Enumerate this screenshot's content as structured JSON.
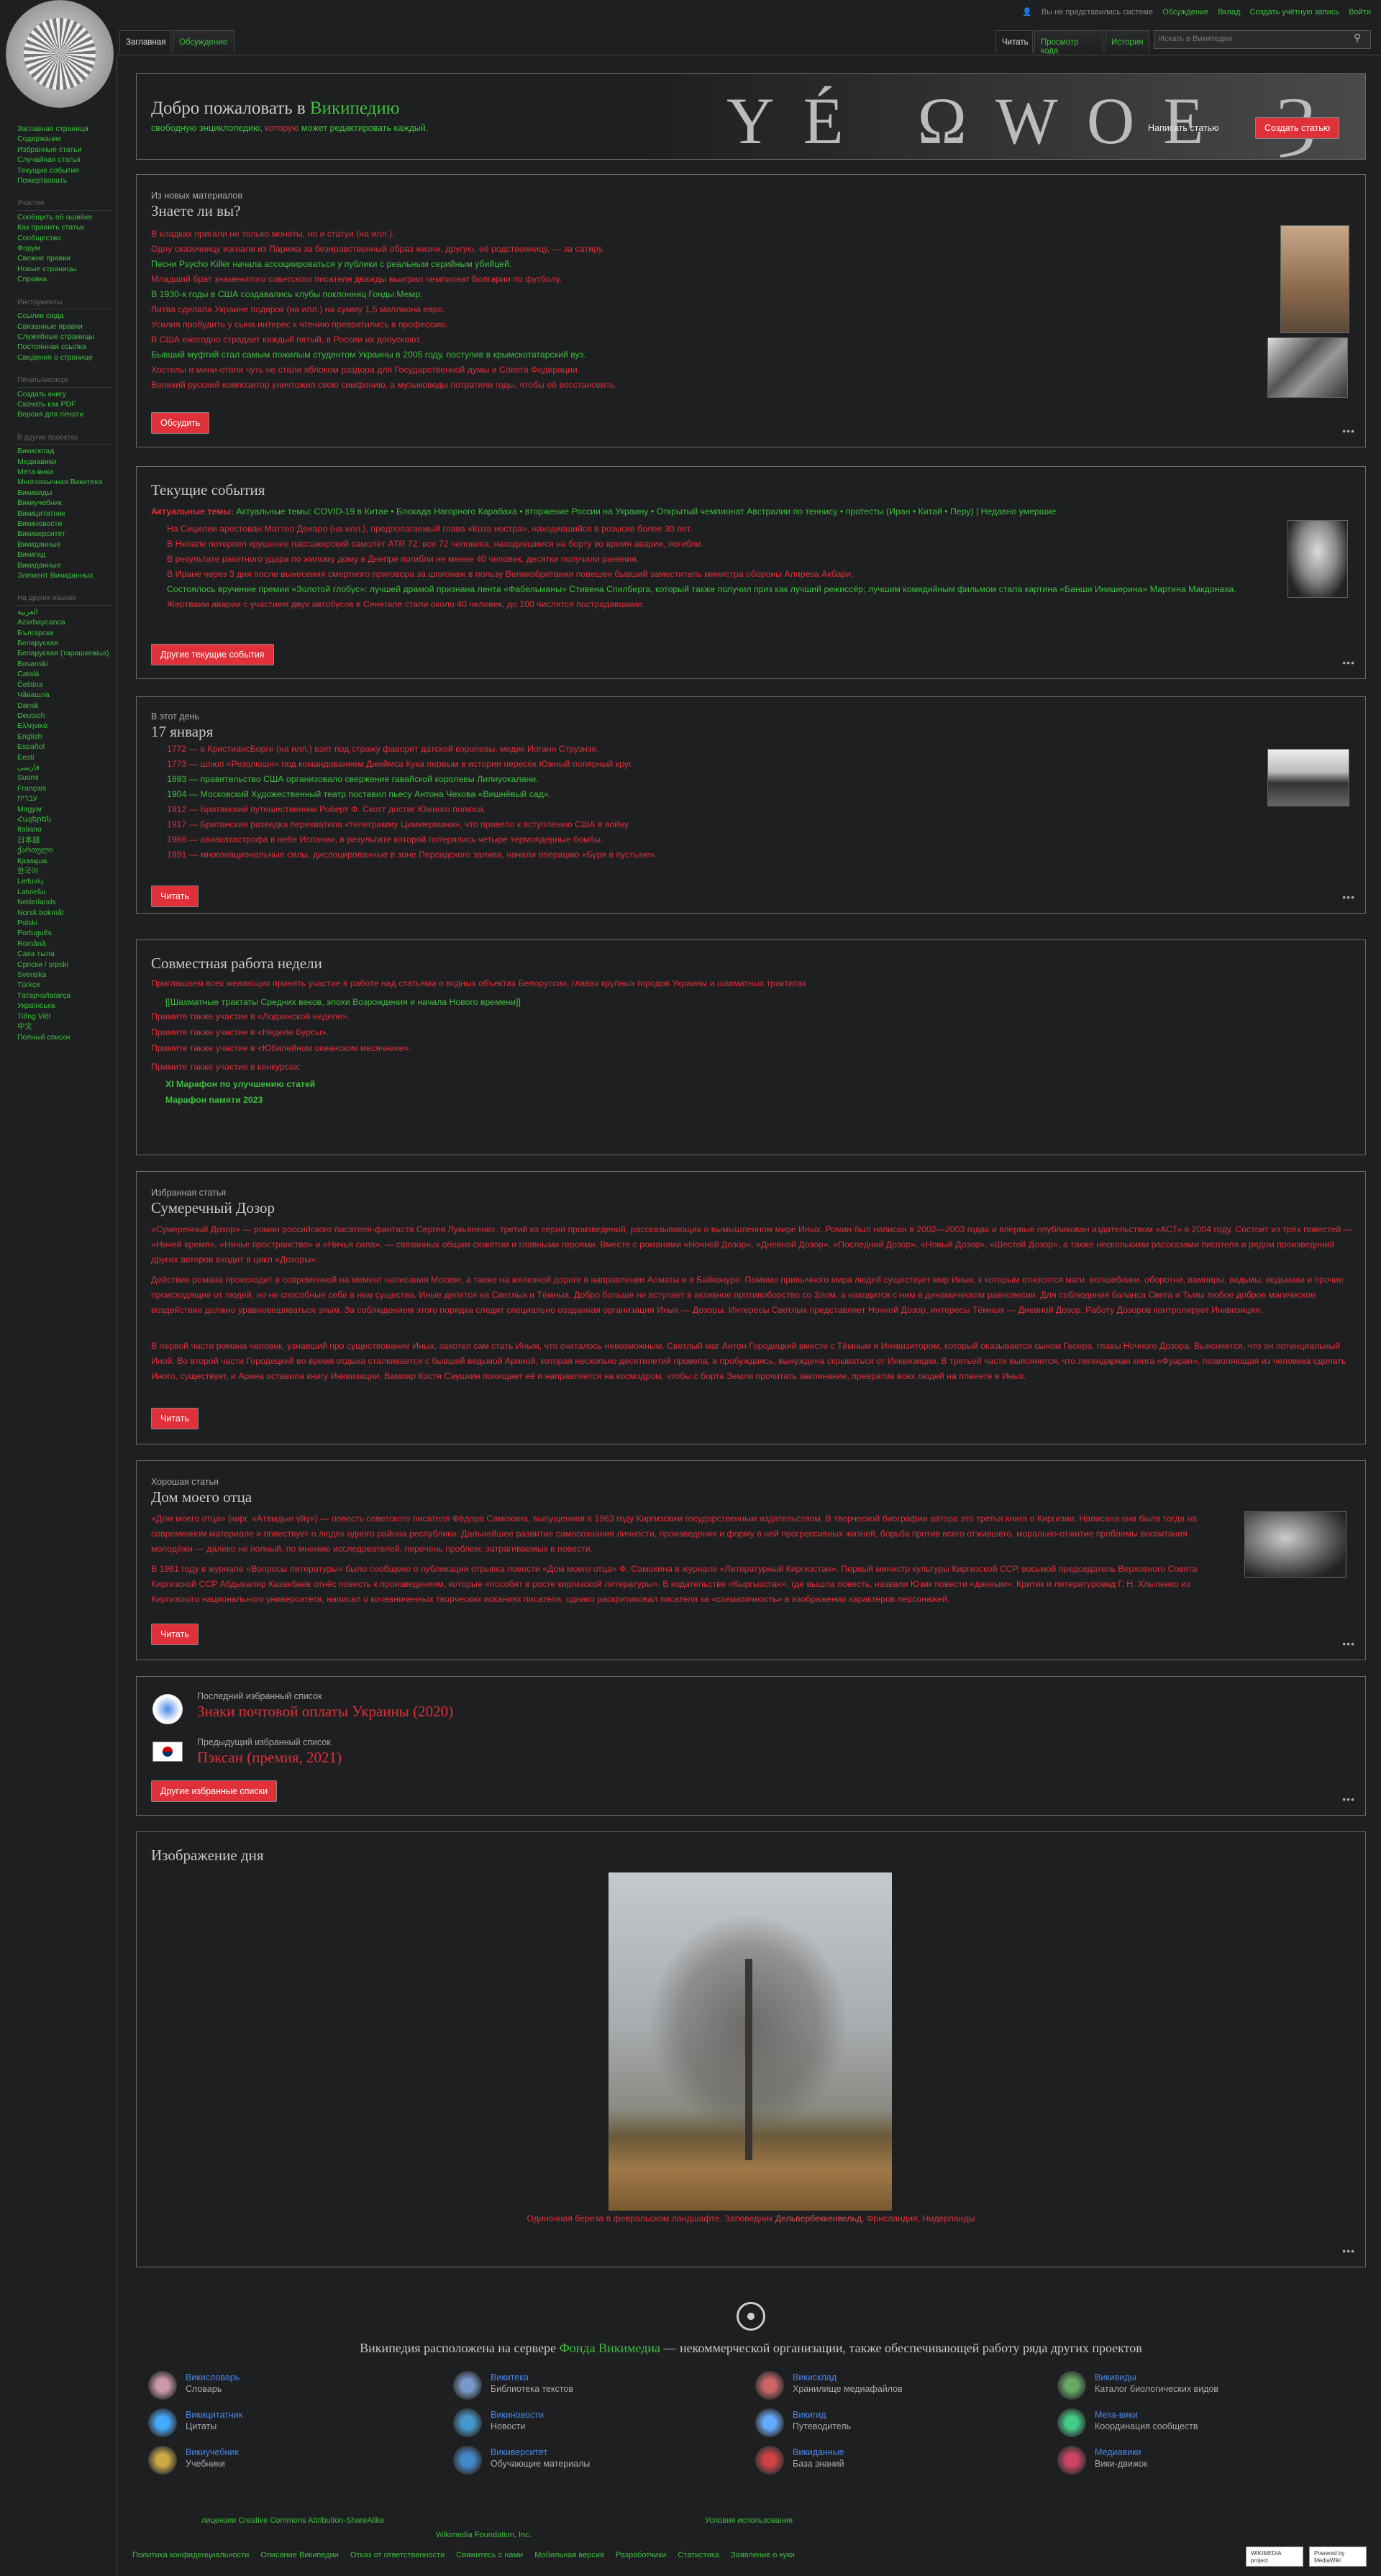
{
  "top": {
    "not_logged": "Вы не представились системе",
    "talk": "Обсуждение",
    "contributions": "Вклад",
    "create_account": "Создать учётную запись",
    "login": "Войти"
  },
  "tabs": {
    "main": "Заглавная",
    "discussion": "Обсуждение",
    "read": "Читать",
    "view_source": "Просмотр кода",
    "history": "История"
  },
  "search": {
    "placeholder": "Искать в Википедии"
  },
  "sidebar": {
    "nav": [
      "Заглавная страница",
      "Содержание",
      "Избранные статьи",
      "Случайная статья",
      "Текущие события",
      "Пожертвовать"
    ],
    "part_h": "Участие",
    "part": [
      "Сообщить об ошибке",
      "Как править статьи",
      "Сообщество",
      "Форум",
      "Свежие правки",
      "Новые страницы",
      "Справка"
    ],
    "tools_h": "Инструменты",
    "tools": [
      "Ссылки сюда",
      "Связанные правки",
      "Служебные страницы",
      "Постоянная ссылка",
      "Сведения о странице"
    ],
    "print_h": "Печать/экспорт",
    "print": [
      "Создать книгу",
      "Скачать как PDF",
      "Версия для печати"
    ],
    "other_h": "В других проектах",
    "other": [
      "Викисклад",
      "Медиавики",
      "Мета-вики",
      "Многоязычная Викитека",
      "Викивиды",
      "Викиучебник",
      "Викицитатник",
      "Викиновости",
      "Викиверситет",
      "Викиданные",
      "Викигид",
      "Викиданные",
      "Элемент Викиданных"
    ],
    "lang_h": "На других языках",
    "langs": [
      "العربية",
      "Azərbaycanca",
      "Български",
      "Беларуская",
      "Беларуская (тарашкевіца)",
      "Bosanski",
      "Català",
      "Čeština",
      "Чӑвашла",
      "Dansk",
      "Deutsch",
      "Ελληνικά",
      "English",
      "Español",
      "Eesti",
      "فارسی",
      "Suomi",
      "Français",
      "עברית",
      "Magyar",
      "Հայերեն",
      "Italiano",
      "日本語",
      "ქართული",
      "Қазақша",
      "한국어",
      "Lietuvių",
      "Latviešu",
      "Nederlands",
      "Norsk bokmål",
      "Polski",
      "Português",
      "Română",
      "Саха тыла",
      "Српски / srpski",
      "Svenska",
      "Türkçe",
      "Татарча/tatarça",
      "Українська",
      "Tiếng Việt",
      "中文",
      "Полный список"
    ]
  },
  "welcome": {
    "pre": "Добро пожаловать в ",
    "link": "Википедию",
    "line2a": "свободную энциклопедию, ",
    "line2b": "которую",
    "line2c": " может редактировать каждый.",
    "btn_write": "Написать статью",
    "btn_create": "Создать статью"
  },
  "dyk": {
    "sub": "Из новых материалов",
    "title": "Знаете ли вы?",
    "items": [
      "В кладках пригали не только монеты, но и статуи (на илл.).",
      "Одну сказочницу изгнали из Парижа за безнравственный образ жизни, другую, её родственницу, — за сатиру.",
      "Песни Psycho Killer начала ассоциироваться у публики с реальным серийным убийцей.",
      "Младший брат знаменитого советского писателя дважды выиграл чемпионат Болгарии по футболу.",
      "В 1930-х годы в США создавались клубы поклонниц Гонды Мемр.",
      "Литва сделала Украине подарок (на илл.) на сумму 1,5 миллиона евро.",
      "Усилия пробудить у сына интерес к чтению превратились в профессию.",
      "В США ежегодно страдает каждый пятый, в России их допускают.",
      "Бывший муфтий стал самым пожилым студентом Украины в 2005 году, поступив в крымскотатарский вуз.",
      "Хостелы и мини-отели чуть не стали яблоком раздора для Государственной думы и Совета Федерации.",
      "Великий русский композитор уничтожил свою симфонию, а музыковеды потратили годы, чтобы её восстановить."
    ],
    "btn": "Обсудить"
  },
  "news": {
    "title": "Текущие события",
    "topics": "Актуальные темы: COVID-19 в Китае • Блокада Нагорного Карабаха • вторжение России на Украину • Открытый чемпионат Австралии по теннису • протесты (Иран • Китай • Перу) | Недавно умершие",
    "items": [
      "На Сицилии арестован Маттео Денаро (на илл.), предполагаемый глава «Коза ностра», находившийся в розыске более 30 лет.",
      "В Непале потерпел крушение пассажирский самолёт ATR 72: все 72 человека, находившиеся на борту во время аварии, погибли.",
      "В результате ракетного удара по жилому дому в Днепре погибли не менее 40 человек, десятки получили ранения.",
      "В Иране через 3 дня после вынесения смертного приговора за шпионаж в пользу Великобритании повешен бывший заместитель министра обороны Алиреза Акбари.",
      "Состоялось вручение премии «Золотой глобус»: лучшей драмой признана лента «Фабельманы» Стивена Спилберга, который также получил приз как лучший режиссёр; лучшим комедийным фильмом стала картина «Банши Инишерина» Мартина Макдонаха.",
      "Жертвами аварии с участием двух автобусов в Сенегале стали около 40 человек, до 100 числятся пострадавшими."
    ],
    "btn": "Другие текущие события"
  },
  "day": {
    "sub": "В этот день",
    "title": "17 января",
    "items": [
      "1772 — в КристиансБорге (на илл.) взят под стражу фаворит датской королевы, медик Иоганн Струэнзе.",
      "1773 — шлюп «Резолюшн» под командованием Джеймса Кука первым в истории пересёк Южный полярный круг.",
      "1893 — правительство США организовало свержение гавайской королевы Лилиуокалани.",
      "1904 — Московский Художественный театр поставил пьесу Антона Чехова «Вишнёвый сад».",
      "1912 — Британский путешественник Роберт Ф. Скотт достиг Южного полюса.",
      "1917 — Британская разведка перехватила «телеграмму Циммермана», что привело к вступлению США в войну.",
      "1966 — авиакатастрофа в небе Испании, в результате которой потерялись четыре термоядерные бомбы.",
      "1991 — многонациональные силы, дислоцированные в зоне Персидского залива, начали операцию «Буря в пустыне»."
    ],
    "btn": "Читать"
  },
  "collab": {
    "title": "Совместная работа недели",
    "invite": "Приглашаем всех желающих принять участие в работе над статьями о водных объектах Белоруссии, главах крупных городов Украины и шахматных трактатах",
    "bracket": "[[Шахматные трактаты Средних веков, эпохи Возрождения и начала Нового времени]]",
    "l1": "Примите также участие в «Лодзинской неделе».",
    "l2": "Примите также участие в «Неделе Бурсы».",
    "l3": "Примите также участие в «Юбилейном океанском месячнике».",
    "l4": "Примите также участие в конкурсах:",
    "c1": "XI Марафон по улучшению статей",
    "c2": "Марафон памяти 2023"
  },
  "feat": {
    "sub": "Избранная статья",
    "title": "Сумеречный Дозор",
    "p1": "«Сумеречный Дозор» — роман российского писателя-фантаста Сергея Лукьяненко, третий из серии произведений, рассказывающих о вымышленном мире Иных. Роман был написан в 2002—2003 годах и впервые опубликован издательством «АСТ» в 2004 году. Состоит из трёх повестей — «Ничей время», «Ничье пространство» и «Ничья сила», — связанных общим сюжетом и главными героями. Вместе с романами «Ночной Дозор», «Дневной Дозор», «Последний Дозор», «Новый Дозор», «Шестой Дозор», а также несколькими рассказами писателя и рядом произведений других авторов входит в цикл «Дозоры».",
    "p2": "Действие романа происходит в современной на момент написания Москве, а также на железной дороге в направлении Алматы и в Байконуре. Помимо привычного мира людей существует мир Иных, к которым относятся маги, волшебники, оборотни, вампиры, ведьмы, ведьмаки и прочие происходящие от людей, но не способные себе в нем существа. Иные делятся на Светлых и Тёмных. Добро больше не вступает в активное противоборство со Злом, а находится с ним в динамическом равновесии. Для соблюдения баланса Света и Тьмы любое доброе магическое воздействие должно уравновешиваться злым. За соблюдением этого порядка следит специально созданная организация Иных — Дозоры. Интересы Светлых представляет Ночной Дозор, интересы Тёмных — Дневной Дозор. Работу Дозоров контролирует Инквизиция.",
    "p3": "В первой части романа человек, узнавший про существование Иных, захотел сам стать Иным, что считалось невозможным. Светлый маг Антон Городецкий вместе с Тёмным и Инквизитором, который оказывается сыном Гесера, главы Ночного Дозора. Выясняется, что он потенциальный Иной. Во второй части Городецкий во время отдыха сталкивается с бывшей ведьмой Ариной, которая несколько десятилетий провела, в пробуждаясь, вынуждена скрываться от Инквизиции. В третьей части выясняется, что легендарная книга «Фуаран», позволяющая из человека сделать Иного, существует, и Арина оставила книгу Инквизиции. Вампир Костя Саушкин похищает её и направляется на космодром, чтобы с борта Земли прочитать заклинание, превратив всех людей на планете в Иных.",
    "btn": "Читать"
  },
  "good": {
    "sub": "Хорошая статья",
    "title": "Дом моего отца",
    "p1": "«Дом моего отца» (кирг. «Атамдын үйү») — повесть советского писателя Фёдора Самохина, выпущенная в 1963 году Киргизским государственным издательством. В творческой биографии автора это третья книга о Киргизии. Написана она была тогда на современном материале и повествует о людях одного района республики. Дальнейшее развитие самосознания личности, произведения и форму в ней прогрессивных жизней, борьба против всего отжившего, морально-отжитие проблемы воспитания молодёжи — далеко не полный, по мнению исследователей, перечень проблем, затрагиваемых в повести.",
    "p2": "В 1961 году в журнале «Вопросы литературы» было сообщено о публикации отрывка повести «Дом моего отца» Ф. Самохина в журнале «Литературный Киргизстан». Первый министр культуры Киргизской ССР, восьмой председатель Верховного Совета Киргизской ССР Абдыкалир Казакбаев отнёс повесть к произведениям, которые «пособят в росте киргизской литературы». В издательстве «Кыргызстан», где вышла повесть, назвали Юзик повести «дачным». Критик и литературовед Г. Н. Хлыпенко из Киргизского национального университета, написал о кочевниченных творческих исканиях писателя, однако раскритиковал писателя за «схематичность» в изображении характеров персонажей.",
    "btn": "Читать"
  },
  "lists": {
    "sub1": "Последний избранный список",
    "t1": "Знаки почтовой оплаты Украины (2020)",
    "sub2": "Предыдущий избранный список",
    "t2": "Пэксан (премия, 2021)",
    "btn": "Другие избранные списки"
  },
  "image": {
    "title": "Изображение дня",
    "caption_a": "Одиночная берёза в февральском ландшафте. Заповедник ",
    "caption_b": "Дельвербеккенвельд",
    "caption_c": ", Фрисландия, Нидерланды"
  },
  "projects": {
    "title_a": "Википедия расположена на сервере ",
    "title_link": "Фонда Викимедиа",
    "title_b": " — некоммерческой организации, также обеспечивающей работу ряда других проектов",
    "items": [
      [
        "Викисловарь",
        "Словарь"
      ],
      [
        "Викитека",
        "Библиотека текстов"
      ],
      [
        "Викисклад",
        "Хранилище медиафайлов"
      ],
      [
        "Викивиды",
        "Каталог биологических видов"
      ],
      [
        "Викицитатник",
        "Цитаты"
      ],
      [
        "Викиновости",
        "Новости"
      ],
      [
        "Викигид",
        "Путеводитель"
      ],
      [
        "Мета-вики",
        "Координация сообществ"
      ],
      [
        "Викиучебник",
        "Учебники"
      ],
      [
        "Викиверситет",
        "Обучающие материалы"
      ],
      [
        "Викиданные",
        "База знаний"
      ],
      [
        "Медиавики",
        "Вики-движок"
      ]
    ]
  },
  "footer": {
    "license": "лицензии Creative Commons Attribution-ShareAlike",
    "terms": "Условия использования",
    "org": "Wikimedia Foundation, Inc.",
    "links": [
      "Политика конфиденциальности",
      "Описание Википедии",
      "Отказ от ответственности",
      "Свяжитесь с нами",
      "Мобильная версия",
      "Разработчики",
      "Статистика",
      "Заявление о куки"
    ],
    "badge1": "WIKIMEDIA project",
    "badge2": "Powered by MediaWiki"
  },
  "colors": {
    "bg": "#1e1f21",
    "link_green": "#3fbf3f",
    "red": "#e0303a",
    "blue": "#4a86e8"
  }
}
